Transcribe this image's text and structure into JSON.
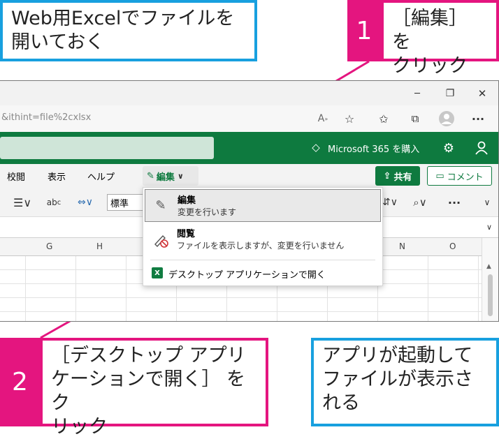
{
  "callouts": {
    "intro": "Web用Excelでファイルを\n開いておく",
    "step1_number": "1",
    "step1_text": "［編集］ を\nクリック",
    "step2_number": "2",
    "step2_text": "［デスクトップ アプリ\nケーションで開く］ をク\nリック",
    "result": "アプリが起動して\nファイルが表示さ\nれる"
  },
  "browser": {
    "url_fragment": "&ithint=file%2cxlsx",
    "minimize": "─",
    "restore": "❐",
    "close": "✕",
    "more": "···"
  },
  "excel": {
    "ms365_label": "Microsoft 365 を購入",
    "menu": [
      "校閲",
      "表示",
      "ヘルプ"
    ],
    "edit_button": "編集",
    "share_button": "共有",
    "comment_button": "コメント",
    "font_box": "標準",
    "more_toolbar": "···",
    "columns": [
      "G",
      "H",
      "N",
      "O"
    ]
  },
  "dropdown": {
    "edit_title": "編集",
    "edit_desc": "変更を行います",
    "view_title": "閲覧",
    "view_desc": "ファイルを表示しますが、変更を行いません",
    "desktop_label": "デスクトップ アプリケーションで開く"
  },
  "colors": {
    "callout_blue": "#18a0df",
    "callout_pink": "#e4157f",
    "excel_green": "#0e7a3f"
  }
}
